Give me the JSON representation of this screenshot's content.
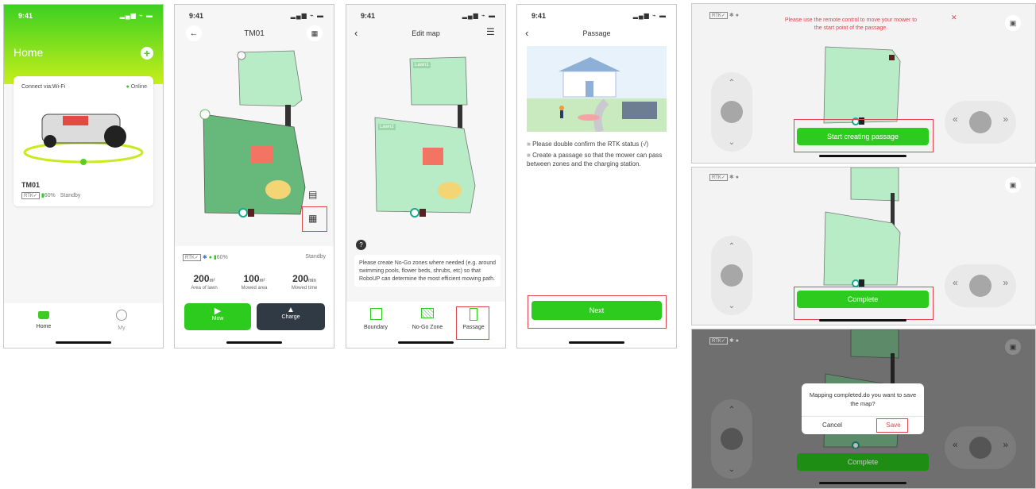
{
  "status": {
    "time": "9:41",
    "signal": "▂▄▆ ⌁ ▬"
  },
  "home": {
    "title": "Home",
    "connect": "Connect via:Wi-Fi",
    "online": "Online",
    "device": "TM01",
    "rtk": "RTK✓",
    "battery": "60%",
    "state": "Standby",
    "tab_home": "Home",
    "tab_my": "My"
  },
  "device": {
    "title": "TM01",
    "rtk": "RTK✓",
    "battery": "60%",
    "state": "Standby",
    "stats": [
      {
        "value": "200",
        "unit": "m²",
        "label": "Area of lawn"
      },
      {
        "value": "100",
        "unit": "m²",
        "label": "Mowed area"
      },
      {
        "value": "200",
        "unit": "min",
        "label": "Mowed time"
      }
    ],
    "mow": "Mow",
    "charge": "Charge"
  },
  "editmap": {
    "title": "Edit map",
    "lawn1": "Lawn1",
    "lawn2": "Lawn2",
    "help": "Please create No-Go zones where needed (e.g. around swimming pools, flower beds, shrubs, etc) so that  RoboUP can determine the most efficient mowing path.",
    "tabs": [
      "Boundary",
      "No-Go Zone",
      "Passage"
    ]
  },
  "passage": {
    "title": "Passage",
    "bullet1": "Please double confirm the RTK status (√)",
    "bullet2": "Create a passage so that the mower can pass between zones and the charging station.",
    "next": "Next"
  },
  "land1": {
    "rtk": "RTK✓",
    "notice": "Please use the remote  control to move your mower to the start point of the passage.",
    "button": "Start creating passage"
  },
  "land2": {
    "rtk": "RTK✓",
    "button": "Complete"
  },
  "land3": {
    "rtk": "RTK✓",
    "dialog": "Mapping completed.do you want to save the map?",
    "cancel": "Cancel",
    "save": "Save",
    "button": "Complete"
  },
  "colors": {
    "green": "#2ecb1f",
    "lawn": "#b8ecc6",
    "zone_dark": "#66b97a",
    "nogo": "#f47464",
    "pool": "#f4d576",
    "red": "#e0454f"
  }
}
